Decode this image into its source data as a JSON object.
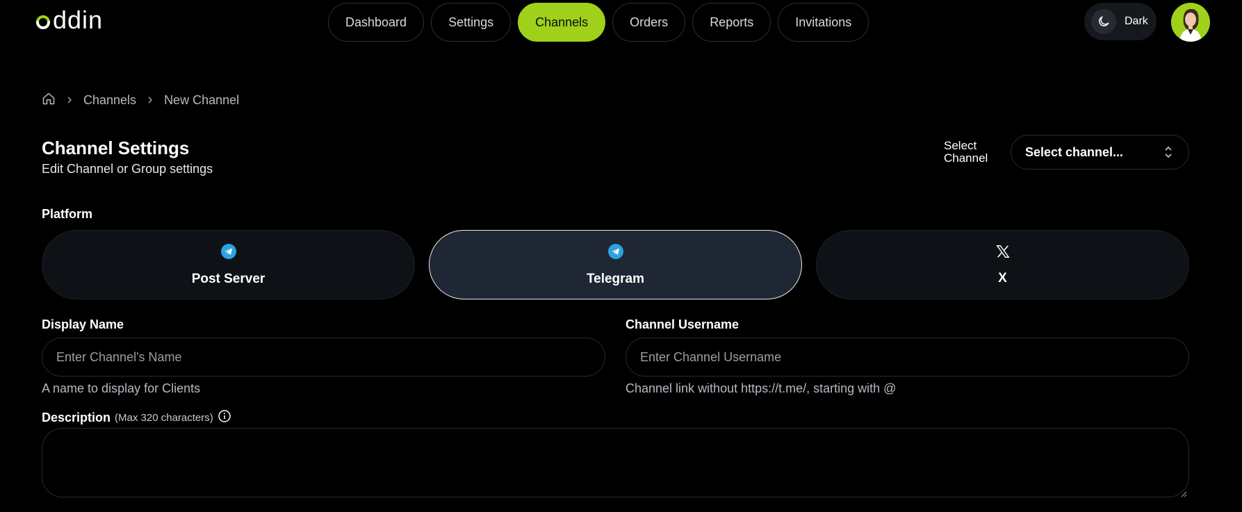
{
  "logo": {
    "text": "ddin"
  },
  "nav": {
    "items": [
      {
        "label": "Dashboard",
        "active": false
      },
      {
        "label": "Settings",
        "active": false
      },
      {
        "label": "Channels",
        "active": true
      },
      {
        "label": "Orders",
        "active": false
      },
      {
        "label": "Reports",
        "active": false
      },
      {
        "label": "Invitations",
        "active": false
      }
    ]
  },
  "theme": {
    "label": "Dark",
    "icon": "moon-icon"
  },
  "breadcrumb": {
    "home_icon": "home-icon",
    "items": [
      "Channels",
      "New Channel"
    ]
  },
  "page": {
    "title": "Channel Settings",
    "subtitle": "Edit Channel or Group settings"
  },
  "select_channel": {
    "label": "Select Channel",
    "value": "Select channel..."
  },
  "platform": {
    "label": "Platform",
    "options": [
      {
        "name": "Post Server",
        "icon": "telegram-icon",
        "selected": false
      },
      {
        "name": "Telegram",
        "icon": "telegram-icon",
        "selected": true
      },
      {
        "name": "X",
        "icon": "x-logo-icon",
        "selected": false
      }
    ]
  },
  "display_name": {
    "label": "Display Name",
    "placeholder": "Enter Channel's Name",
    "value": "",
    "help": "A name to display for Clients"
  },
  "channel_username": {
    "label": "Channel Username",
    "placeholder": "Enter Channel Username",
    "value": "",
    "help": "Channel link without https://t.me/, starting with @"
  },
  "description": {
    "label": "Description",
    "note": "(Max 320 characters)",
    "value": ""
  },
  "colors": {
    "accent": "#9fd11a",
    "background": "#000000",
    "card": "#0e1116",
    "card_selected": "#1e2733",
    "telegram": "#2aa3e0"
  }
}
